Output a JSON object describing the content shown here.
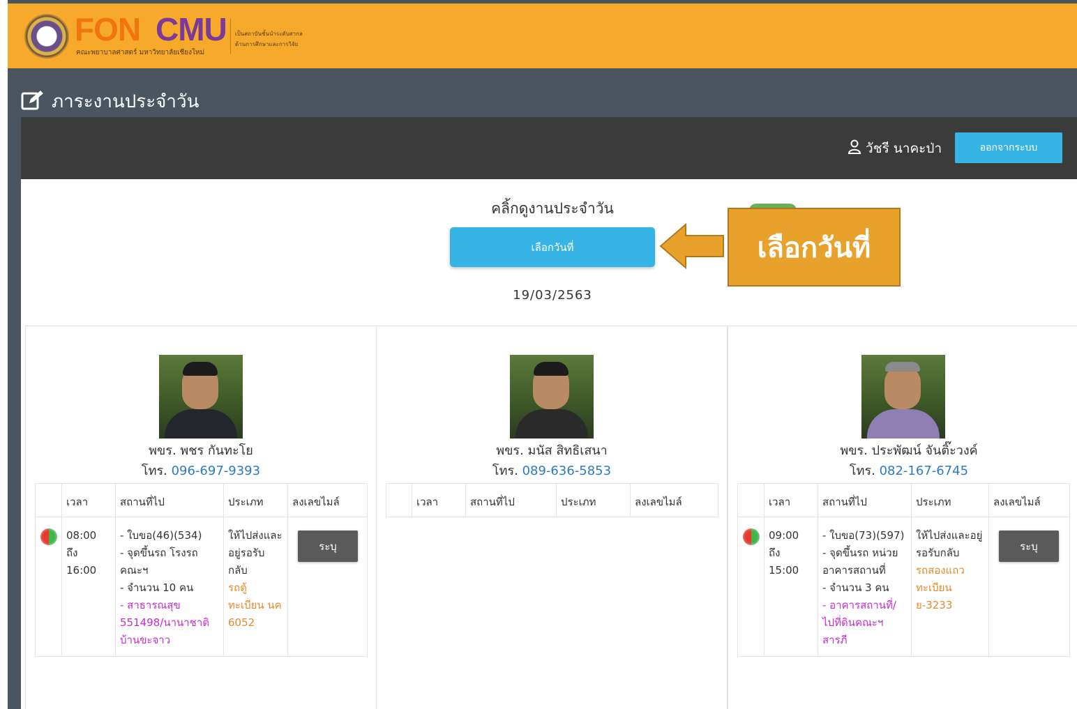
{
  "header": {
    "logo_primary": "FON",
    "logo_secondary": "CMU",
    "logo_subtitle": "คณะพยาบาลศาสตร์ มหาวิทยาลัยเชียงใหม่",
    "logo_tagline_1": "เป็นสถาบันชั้นนำระดับสากล",
    "logo_tagline_2": "ด้านการศึกษาและการวิจัย"
  },
  "page": {
    "title": "ภาระงานประจำวัน"
  },
  "userbar": {
    "user_name": "วัชรี นาคะป่า",
    "logout_label": "ออกจากระบบ"
  },
  "picker": {
    "heading": "คลิ้กดูงานประจำวัน",
    "button_label": "เลือกวันที่",
    "selected_date": "19/03/2563",
    "annotation": "เลือกวันที่"
  },
  "table_headers": [
    "เวลา",
    "สถานที่ไป",
    "ประเภท",
    "ลงเลขไมล์"
  ],
  "drivers": [
    {
      "name": "พขร. พชร กันทะโย",
      "phone_prefix": "โทร.",
      "phone": "096-697-9393",
      "jobs": [
        {
          "time": [
            "08:00",
            "ถึง",
            "16:00"
          ],
          "destination": [
            "- ใบขอ(46)(534)",
            "- จุดขึ้นรถ โรงรถคณะฯ",
            "- จำนวน 10 คน"
          ],
          "destination_highlight": "- สาธารณสุข 551498/นานาชาติ บ้านขะจาว",
          "type": "ให้ไปส่งและอยู่รอรับกลับ",
          "vehicle": "รถตู้ ทะเบียน นค 6052",
          "action": "ระบุ"
        }
      ]
    },
    {
      "name": "พขร. มนัส สิทธิเสนา",
      "phone_prefix": "โทร.",
      "phone": "089-636-5853",
      "jobs": []
    },
    {
      "name": "พขร. ประพัฒน์ จันติ๊ะวงค์",
      "phone_prefix": "โทร.",
      "phone": "082-167-6745",
      "jobs": [
        {
          "time": [
            "09:00",
            "ถึง",
            "15:00"
          ],
          "destination": [
            "- ใบขอ(73)(597)",
            "- จุดขึ้นรถ หน่วยอาคารสถานที่",
            "- จำนวน 3 คน"
          ],
          "destination_highlight": "- อาคารสถานที่/ไปที่ดินคณะฯ สารภี",
          "type": "ให้ไปส่งและอยู่รอรับกลับ",
          "vehicle": "รถสองแถว ทะเบียน ย-3233",
          "action": "ระบุ"
        }
      ]
    }
  ],
  "colors": {
    "header": "#f7a92b",
    "page_bg": "#4a5560",
    "userbar": "#3b3b3b",
    "primary_button": "#35b4e5",
    "specify_button": "#5a5a5a",
    "callout": "#e8a22b",
    "phone_link": "#2b7bc4",
    "vehicle_text": "#e48a2a",
    "destination_highlight": "#c72bcf"
  },
  "icons": [
    "edit-icon",
    "user-icon",
    "status-dot-icon",
    "arrow-left-icon"
  ]
}
